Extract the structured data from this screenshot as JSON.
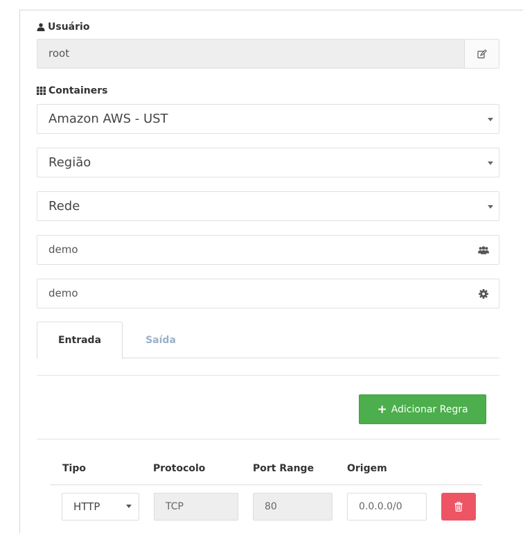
{
  "user": {
    "label": "Usuário",
    "value": "root"
  },
  "containers": {
    "label": "Containers",
    "provider": "Amazon AWS - UST",
    "region": "Região",
    "network": "Rede",
    "group_value": "demo",
    "config_value": "demo"
  },
  "tabs": [
    {
      "label": "Entrada",
      "active": true
    },
    {
      "label": "Saída",
      "active": false
    }
  ],
  "add_rule_label": "Adicionar Regra",
  "rules_table": {
    "headers": [
      "Tipo",
      "Protocolo",
      "Port Range",
      "Origem"
    ],
    "rows": [
      {
        "tipo": "HTTP",
        "protocolo": "TCP",
        "port_range": "80",
        "origem": "0.0.0.0/0"
      }
    ]
  },
  "colors": {
    "add_button": "#4cae4c",
    "delete_button": "#ed5565",
    "inactive_tab": "#9ab0c8"
  }
}
